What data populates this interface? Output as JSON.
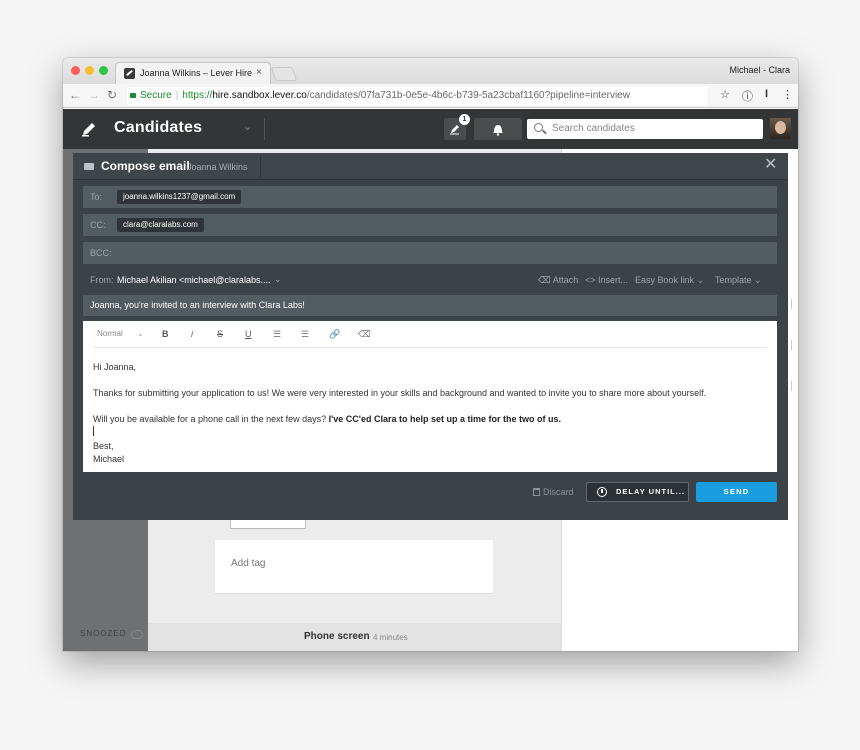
{
  "browser": {
    "tab_title": "Joanna Wilkins – Lever Hire",
    "tab_close": "×",
    "profile_name": "Michael - Clara",
    "secure_label": "Secure",
    "url_scheme": "https://",
    "url_host": "hire.sandbox.lever.co",
    "url_path": "/candidates/07fa731b-0e5e-4b6c-b739-5a23cbaf1160?pipeline=interview"
  },
  "app": {
    "title": "Candidates",
    "notification_count": "1",
    "search_placeholder": "Search candidates"
  },
  "background": {
    "add_tag": "Add tag",
    "phone_screen_title": "Phone screen",
    "phone_screen_duration": "4 minutes",
    "snoozed_label": "SNOOZED",
    "snoozed_count": "0"
  },
  "compose": {
    "title": "Compose email",
    "candidate": "Joanna Wilkins",
    "to_label": "To:",
    "to_value": "joanna.wilkins1237@gmail.com",
    "cc_label": "CC:",
    "cc_value": "clara@claralabs.com",
    "bcc_label": "BCC:",
    "from_label": "From:",
    "from_value": "Michael Akilian <michael@claralabs....",
    "attach": "Attach",
    "insert": "<> Insert...",
    "easy_book": "Easy Book link",
    "template": "Template",
    "subject": "Joanna, you're invited to an interview with Clara Labs!",
    "format": "Normal",
    "body_greeting": "Hi Joanna,",
    "body_line1": "Thanks for submitting your application to us!  We were very interested in your skills and background and wanted to invite you to share more about yourself.",
    "body_line2": "Will you be available for a phone call in the next few days?",
    "body_line2_bold": "I've CC'ed Clara to help set up a time for the two of us.",
    "body_signoff": "Best,",
    "body_name": "Michael",
    "discard": "Discard",
    "delay": "DELAY UNTIL...",
    "send": "SEND"
  }
}
